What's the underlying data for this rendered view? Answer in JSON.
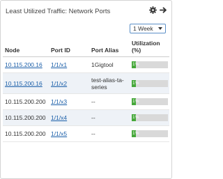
{
  "widget": {
    "title": "Least Utilized Traffic: Network Ports",
    "icons": [
      "gear-icon",
      "arrow-right-icon"
    ],
    "period": {
      "selected": "1 Week"
    }
  },
  "table": {
    "headers": {
      "node": "Node",
      "port_id": "Port ID",
      "port_alias": "Port Alias",
      "utilization": "Utilization (%)"
    },
    "rows": [
      {
        "node": "10.115.200.16",
        "port_id": "1/1/x1",
        "port_alias": "1Gigtool",
        "utilization_label": "1%",
        "utilization": 1
      },
      {
        "node": "10.115.200.16",
        "port_id": "1/1/x2",
        "port_alias": "test-alias-ta-series",
        "utilization_label": "1%",
        "utilization": 1
      },
      {
        "node": "10.115.200.200",
        "port_id": "1/1/x3",
        "port_alias": "--",
        "utilization_label": "1%",
        "utilization": 1
      },
      {
        "node": "10.115.200.200",
        "port_id": "1/1/x4",
        "port_alias": "--",
        "utilization_label": "1%",
        "utilization": 1
      },
      {
        "node": "10.115.200.200",
        "port_id": "1/1/x5",
        "port_alias": "--",
        "utilization_label": "1%",
        "utilization": 1
      }
    ]
  },
  "colors": {
    "bar_fill": "#46a83a",
    "bar_track": "#d9d9d9",
    "link": "#1a5ea8",
    "dropdown_border": "#5b8fc7"
  }
}
